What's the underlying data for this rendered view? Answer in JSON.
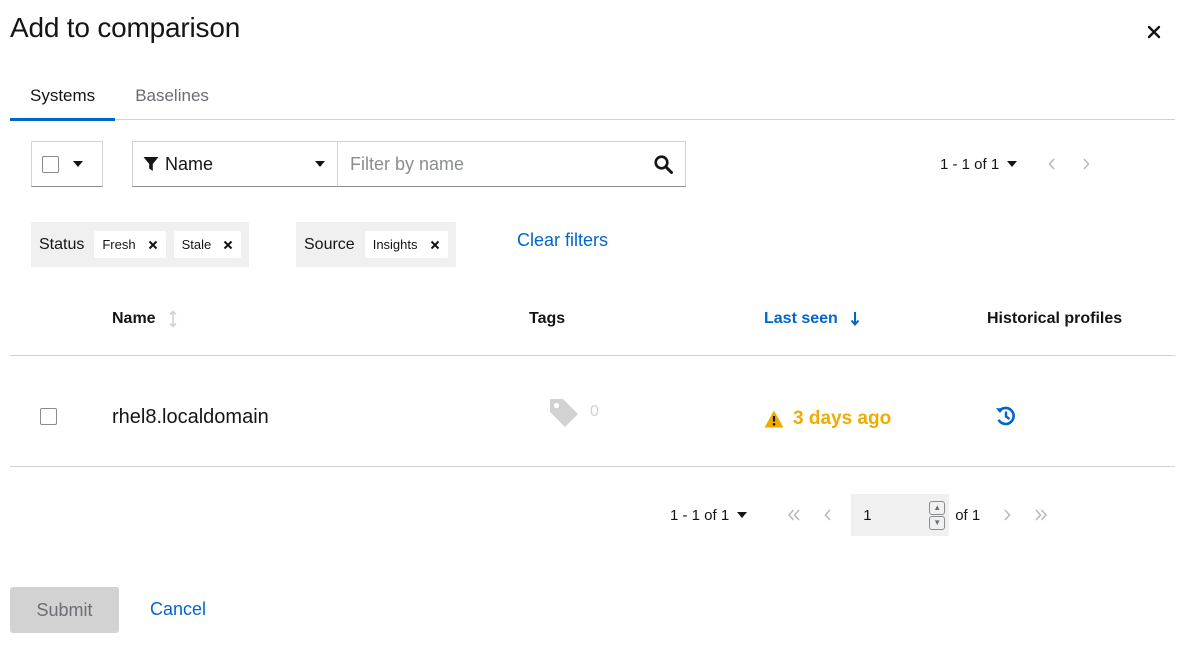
{
  "modal": {
    "title": "Add to comparison"
  },
  "tabs": [
    {
      "label": "Systems",
      "active": true
    },
    {
      "label": "Baselines",
      "active": false
    }
  ],
  "toolbar": {
    "filter_type": "Name",
    "filter_placeholder": "Filter by name",
    "filter_value": ""
  },
  "pagination_top": {
    "range": "1 - 1 of 1"
  },
  "chip_groups": [
    {
      "label": "Status",
      "chips": [
        "Fresh",
        "Stale"
      ]
    },
    {
      "label": "Source",
      "chips": [
        "Insights"
      ]
    }
  ],
  "clear_filters": "Clear filters",
  "table": {
    "columns": [
      "Name",
      "Tags",
      "Last seen",
      "Historical profiles"
    ],
    "rows": [
      {
        "name": "rhel8.localdomain",
        "tags_count": "0",
        "last_seen": "3 days ago"
      }
    ]
  },
  "pagination_bottom": {
    "range": "1 - 1 of 1",
    "page": "1",
    "of_pages": "of 1"
  },
  "footer": {
    "submit": "Submit",
    "cancel": "Cancel"
  },
  "colors": {
    "accent": "#0066cc",
    "warning": "#f0ab00",
    "disabled": "#d2d2d2"
  }
}
